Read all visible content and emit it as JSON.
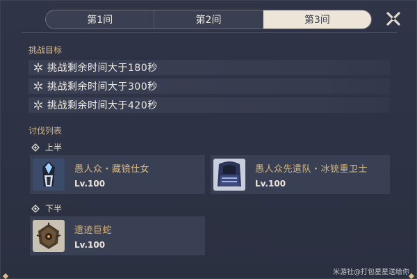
{
  "tabs": [
    {
      "label": "第1间",
      "active": false
    },
    {
      "label": "第2间",
      "active": false
    },
    {
      "label": "第3间",
      "active": true
    }
  ],
  "close_icon": "close-icon",
  "goals": {
    "title": "挑战目标",
    "items": [
      {
        "text": "挑战剩余时间大于180秒",
        "icon": "snowflake-icon"
      },
      {
        "text": "挑战剩余时间大于300秒",
        "icon": "snowflake-icon"
      },
      {
        "text": "挑战剩余时间大于420秒",
        "icon": "snowflake-icon"
      }
    ]
  },
  "enemies": {
    "title": "讨伐列表",
    "first_half": {
      "label": "上半",
      "list": [
        {
          "name": "愚人众・藏镜仕女",
          "level": "Lv.100",
          "icon": "mirror-maiden-portrait"
        },
        {
          "name": "愚人众先遣队・冰铳重卫士",
          "level": "Lv.100",
          "icon": "cryo-gunner-portrait"
        }
      ]
    },
    "second_half": {
      "label": "下半",
      "list": [
        {
          "name": "遗迹巨蛇",
          "level": "Lv.100",
          "icon": "ruin-serpent-portrait"
        }
      ]
    }
  },
  "watermark": "米游社@打包星星送给你",
  "colors": {
    "background": "#2c3142",
    "accent_gold": "#d8b985",
    "active_tab": "#ece5d8",
    "row_bg": "#3a4053"
  }
}
